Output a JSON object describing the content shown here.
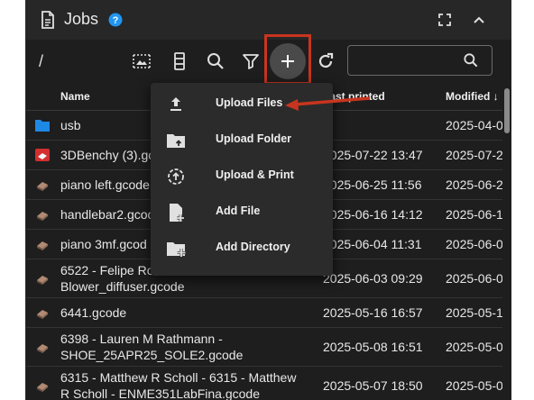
{
  "header": {
    "title": "Jobs"
  },
  "toolbar": {
    "path": "/",
    "search_placeholder": ""
  },
  "columns": {
    "name": "Name",
    "last_printed": "Last printed",
    "modified": "Modified ↓"
  },
  "rows": [
    {
      "icon": "folder-icon",
      "name": "usb",
      "name2": "",
      "printed": "--",
      "modified": "2025-04-0"
    },
    {
      "icon": "gcode-thumbnail-icon",
      "name": "3DBenchy (3).gco",
      "name2": "",
      "printed": "2025-07-22 13:47",
      "modified": "2025-07-2"
    },
    {
      "icon": "gcode-thumbnail-icon",
      "name": "piano left.gcode",
      "name2": "",
      "printed": "2025-06-25 11:56",
      "modified": "2025-06-2"
    },
    {
      "icon": "gcode-thumbnail-icon",
      "name": "handlebar2.gcoo",
      "name2": "",
      "printed": "2025-06-16 14:12",
      "modified": "2025-06-1"
    },
    {
      "icon": "gcode-thumbnail-icon",
      "name": "piano 3mf.gcod",
      "name2": "",
      "printed": "2025-06-04 11:31",
      "modified": "2025-06-0"
    },
    {
      "icon": "gcode-thumbnail-icon",
      "name": "6522 - Felipe Ro",
      "name2": "Blower_diffuser.gcode",
      "printed": "2025-06-03 09:29",
      "modified": "2025-06-0"
    },
    {
      "icon": "gcode-thumbnail-icon",
      "name": "6441.gcode",
      "name2": "",
      "printed": "2025-05-16 16:57",
      "modified": "2025-05-1"
    },
    {
      "icon": "gcode-thumbnail-icon",
      "name": "6398 - Lauren M Rathmann -",
      "name2": "SHOE_25APR25_SOLE2.gcode",
      "printed": "2025-05-08 16:51",
      "modified": "2025-05-0"
    },
    {
      "icon": "gcode-thumbnail-icon",
      "name": "6315 - Matthew R Scholl - 6315 - Matthew",
      "name2": "R Scholl - ENME351LabFina.gcode",
      "printed": "2025-05-07 18:50",
      "modified": "2025-05-0"
    }
  ],
  "menu": {
    "items": [
      {
        "label": "Upload Files",
        "icon": "upload-icon"
      },
      {
        "label": "Upload Folder",
        "icon": "folder-upload-icon"
      },
      {
        "label": "Upload & Print",
        "icon": "upload-print-icon"
      },
      {
        "label": "Add File",
        "icon": "file-plus-icon"
      },
      {
        "label": "Add Directory",
        "icon": "folder-plus-icon"
      }
    ]
  },
  "colors": {
    "accent": "#2196f3",
    "callout": "#c8351f",
    "panel": "#1e1e1e",
    "folder": "#1e88e5"
  }
}
